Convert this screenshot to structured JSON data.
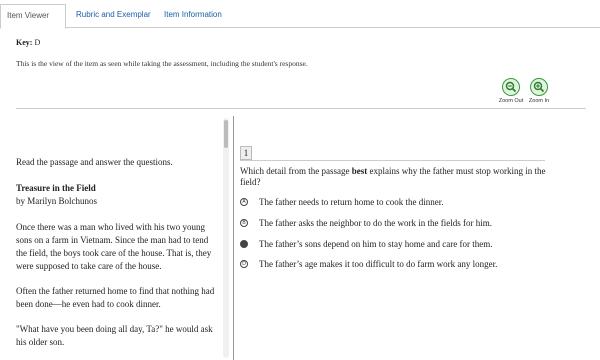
{
  "tabs": [
    {
      "label": "Item Viewer",
      "active": true
    },
    {
      "label": "Rubric and Exemplar",
      "active": false
    },
    {
      "label": "Item Information",
      "active": false
    }
  ],
  "key": {
    "label": "Key:",
    "value": "D"
  },
  "description": "This is the view of the item as seen while taking the assessment, including the student's response.",
  "zoom": {
    "out_label": "Zoom Out",
    "in_label": "Zoom In"
  },
  "passage": {
    "instructions": "Read the passage and answer the questions.",
    "title": "Treasure in the Field",
    "author": "by Marilyn Bolchunos",
    "paragraphs": [
      "Once there was a man who lived with his two young sons on a farm in Vietnam. Since the man had to tend the field, the boys took care of the house. That is, they were supposed to take care of the house.",
      "Often the father returned home to find that nothing had been done—he even had to cook dinner.",
      "\"What have you been doing all day, Ta?\" he would ask his older son."
    ]
  },
  "question": {
    "number": "1",
    "stem_before": "Which detail from the passage ",
    "stem_bold": "best",
    "stem_after": " explains why the father must stop working in the field?",
    "options": [
      {
        "letter": "A",
        "text": "The father needs to return home to cook the dinner.",
        "selected": false
      },
      {
        "letter": "B",
        "text": "The father asks the neighbor to do the work in the fields for him.",
        "selected": false
      },
      {
        "letter": "C",
        "text": "The father’s sons depend on him to stay home and care for them.",
        "selected": true
      },
      {
        "letter": "D",
        "text": "The father’s age makes it too difficult to do farm work any longer.",
        "selected": false
      }
    ]
  }
}
